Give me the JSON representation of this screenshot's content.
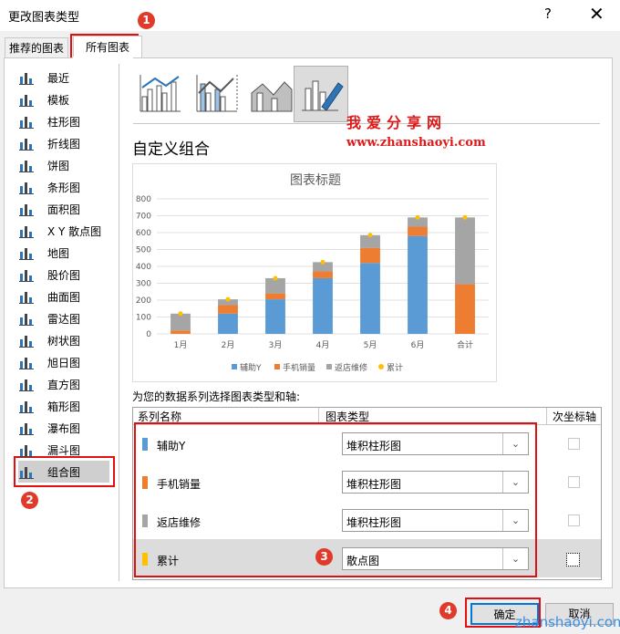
{
  "window": {
    "title": "更改图表类型",
    "help": "?",
    "close": "✕"
  },
  "tabs": {
    "recommended": "推荐的图表",
    "all": "所有图表"
  },
  "sidebar": {
    "items": [
      {
        "label": "最近",
        "icon": "recent-icon"
      },
      {
        "label": "模板",
        "icon": "template-icon"
      },
      {
        "label": "柱形图",
        "icon": "column-chart-icon"
      },
      {
        "label": "折线图",
        "icon": "line-chart-icon"
      },
      {
        "label": "饼图",
        "icon": "pie-chart-icon"
      },
      {
        "label": "条形图",
        "icon": "bar-chart-icon"
      },
      {
        "label": "面积图",
        "icon": "area-chart-icon"
      },
      {
        "label": "X Y 散点图",
        "icon": "scatter-chart-icon"
      },
      {
        "label": "地图",
        "icon": "map-chart-icon"
      },
      {
        "label": "股价图",
        "icon": "stock-chart-icon"
      },
      {
        "label": "曲面图",
        "icon": "surface-chart-icon"
      },
      {
        "label": "雷达图",
        "icon": "radar-chart-icon"
      },
      {
        "label": "树状图",
        "icon": "treemap-chart-icon"
      },
      {
        "label": "旭日图",
        "icon": "sunburst-chart-icon"
      },
      {
        "label": "直方图",
        "icon": "histogram-chart-icon"
      },
      {
        "label": "箱形图",
        "icon": "box-chart-icon"
      },
      {
        "label": "瀑布图",
        "icon": "waterfall-chart-icon"
      },
      {
        "label": "漏斗图",
        "icon": "funnel-chart-icon"
      },
      {
        "label": "组合图",
        "icon": "combo-chart-icon"
      }
    ],
    "selected": "组合图"
  },
  "badges": [
    "1",
    "2",
    "3",
    "4"
  ],
  "watermark": {
    "line1": "我爱分享网",
    "line2": "www.zhanshaoyi.com",
    "bottom": "zhanshaoyi.com"
  },
  "main": {
    "section_title": "自定义组合",
    "series_prompt": "为您的数据系列选择图表类型和轴:",
    "headers": {
      "name": "系列名称",
      "type": "图表类型",
      "secondary": "次坐标轴"
    },
    "rows": [
      {
        "name": "辅助Y",
        "type": "堆积柱形图",
        "color": "#5b9bd5",
        "secondary": false
      },
      {
        "name": "手机销量",
        "type": "堆积柱形图",
        "color": "#ed7d31",
        "secondary": false
      },
      {
        "name": "返店维修",
        "type": "堆积柱形图",
        "color": "#a5a5a5",
        "secondary": false
      },
      {
        "name": "累计",
        "type": "散点图",
        "color": "#ffc000",
        "secondary": false
      }
    ]
  },
  "buttons": {
    "ok": "确定",
    "cancel": "取消"
  },
  "chart_data": {
    "type": "bar",
    "title": "图表标题",
    "categories": [
      "1月",
      "2月",
      "3月",
      "4月",
      "5月",
      "6月",
      "合计"
    ],
    "ylim": [
      0,
      800
    ],
    "yticks": [
      0,
      100,
      200,
      300,
      400,
      500,
      600,
      700,
      800
    ],
    "stacked": true,
    "series": [
      {
        "name": "辅助Y",
        "color": "#5b9bd5",
        "values": [
          0,
          120,
          205,
          330,
          420,
          580,
          0
        ]
      },
      {
        "name": "手机销量",
        "color": "#ed7d31",
        "values": [
          20,
          50,
          35,
          40,
          90,
          55,
          295
        ]
      },
      {
        "name": "返店维修",
        "color": "#a5a5a5",
        "values": [
          100,
          35,
          90,
          55,
          75,
          55,
          395
        ]
      },
      {
        "name": "累计",
        "color": "#ffc000",
        "type": "scatter",
        "values": [
          120,
          205,
          330,
          425,
          585,
          690,
          690
        ]
      }
    ],
    "legend_position": "bottom",
    "grid": true
  }
}
